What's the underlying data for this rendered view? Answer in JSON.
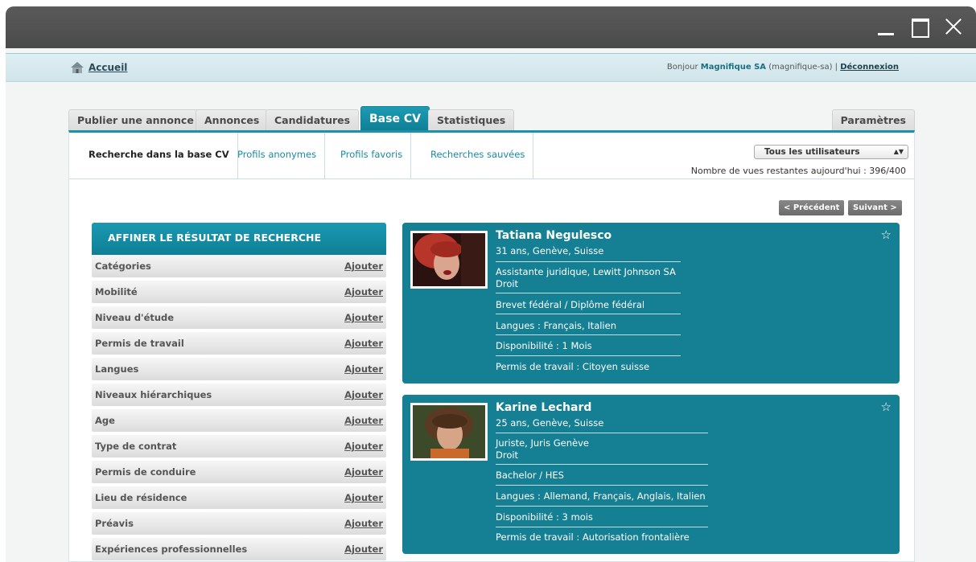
{
  "header": {
    "home_label": "Accueil",
    "greeting_prefix": "Bonjour",
    "company": "Magnifique SA",
    "username": "(magnifique-sa)",
    "separator": "|",
    "logout_label": "Déconnexion"
  },
  "tabs": [
    {
      "label": "Publier une annonce"
    },
    {
      "label": "Annonces"
    },
    {
      "label": "Candidatures"
    },
    {
      "label": "Base CV",
      "active": true
    },
    {
      "label": "Statistiques"
    }
  ],
  "settings_tab": "Paramètres",
  "subtabs": [
    {
      "label": "Recherche dans la base CV",
      "active": true
    },
    {
      "label": "Profils anonymes"
    },
    {
      "label": "Profils favoris"
    },
    {
      "label": "Recherches sauvées"
    }
  ],
  "user_filter": {
    "selected": "Tous les utilisateurs"
  },
  "views_remaining": "Nombre de vues restantes aujourd'hui : 396/400",
  "pager": {
    "prev": "< Précédent",
    "next": "Suivant >"
  },
  "sidebar": {
    "title": "AFFINER LE RÉSULTAT DE RECHERCHE",
    "add_label": "Ajouter",
    "items": [
      {
        "label": "Catégories"
      },
      {
        "label": "Mobilité"
      },
      {
        "label": "Niveau d'étude"
      },
      {
        "label": "Permis de travail"
      },
      {
        "label": "Langues"
      },
      {
        "label": "Niveaux hiérarchiques"
      },
      {
        "label": "Age"
      },
      {
        "label": "Type de contrat"
      },
      {
        "label": "Permis de conduire"
      },
      {
        "label": "Lieu de résidence"
      },
      {
        "label": "Préavis"
      },
      {
        "label": "Expériences professionnelles"
      }
    ]
  },
  "profiles": [
    {
      "name": "Tatiana Negulesco",
      "info": "31 ans, Genève, Suisse",
      "position": "Assistante juridique, Lewitt Johnson SA",
      "field": "Droit",
      "education": "Brevet fédéral / Diplôme fédéral",
      "languages": "Langues : Français, Italien",
      "availability": "Disponibilité : 1 Mois",
      "permit": "Permis de travail : Citoyen suisse"
    },
    {
      "name": "Karine Lechard",
      "info": "25 ans, Genève, Suisse",
      "position": "Juriste, Juris Genève",
      "field": "Droit",
      "education": "Bachelor / HES",
      "languages": "Langues : Allemand, Français, Anglais, Italien",
      "availability": "Disponibilité : 3 mois",
      "permit": "Permis de travail : Autorisation frontalière"
    }
  ],
  "colors": {
    "accent": "#157f94",
    "tab_active": "#1a92aa",
    "link": "#1a8aa3"
  },
  "icons": [
    "home-icon",
    "star-icon",
    "minimize-icon",
    "maximize-icon",
    "close-icon",
    "chevron-updown-icon"
  ]
}
